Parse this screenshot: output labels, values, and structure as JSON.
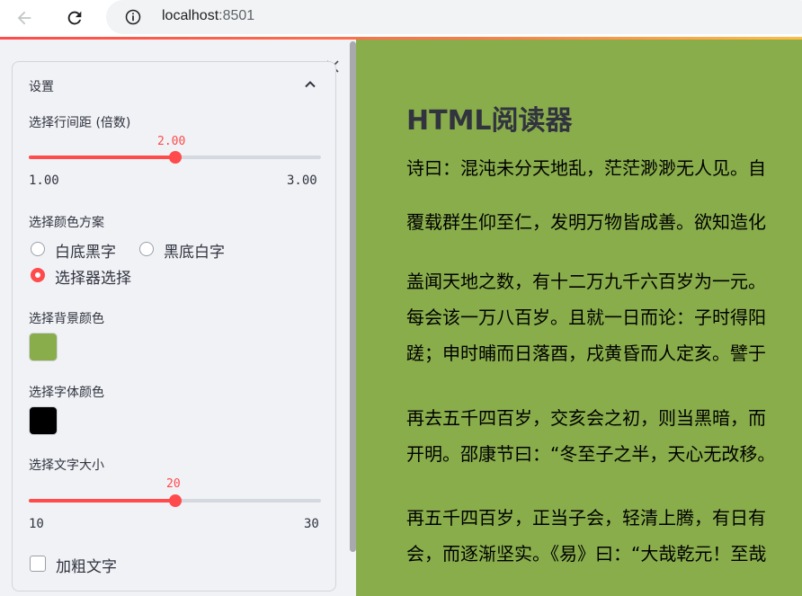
{
  "browser": {
    "url_host": "localhost",
    "url_port": ":8501"
  },
  "sidebar": {
    "expander_title": "设置",
    "line_spacing": {
      "label": "选择行间距 (倍数)",
      "value": 2.0,
      "value_text": "2.00",
      "min": 1.0,
      "max": 3.0,
      "min_text": "1.00",
      "max_text": "3.00"
    },
    "color_scheme": {
      "label": "选择颜色方案",
      "options": [
        "白底黑字",
        "黑底白字",
        "选择器选择"
      ],
      "selected": "选择器选择"
    },
    "bg_color": {
      "label": "选择背景颜色",
      "value": "#89ad4b"
    },
    "font_color": {
      "label": "选择字体颜色",
      "value": "#000000"
    },
    "font_size": {
      "label": "选择文字大小",
      "value": 20,
      "value_text": "20",
      "min": 10,
      "max": 30,
      "min_text": "10",
      "max_text": "30"
    },
    "bold": {
      "label": "加粗文字",
      "checked": false
    }
  },
  "main": {
    "title": "HTML阅读器",
    "paragraphs": [
      [
        "诗曰：混沌未分天地乱，茫茫渺渺无人见。自"
      ],
      [
        "覆载群生仰至仁，发明万物皆成善。欲知造化"
      ],
      [
        "盖闻天地之数，有十二万九千六百岁为一元。",
        "每会该一万八百岁。且就一日而论：子时得阳",
        "蹉；申时晡而日落酉，戌黄昏而人定亥。譬于"
      ],
      [
        "再去五千四百岁，交亥会之初，则当黑暗，而",
        "开明。邵康节曰：“冬至子之半，天心无改移。"
      ],
      [
        "再五千四百岁，正当子会，轻清上腾，有日有",
        "会，而逐渐坚实。《易》曰：“大哉乾元！至哉"
      ]
    ]
  },
  "colors": {
    "accent": "#ff4b4b",
    "sidebar_bg": "#f0f2f6",
    "content_bg": "#89ad4b",
    "text": "#31333f"
  }
}
